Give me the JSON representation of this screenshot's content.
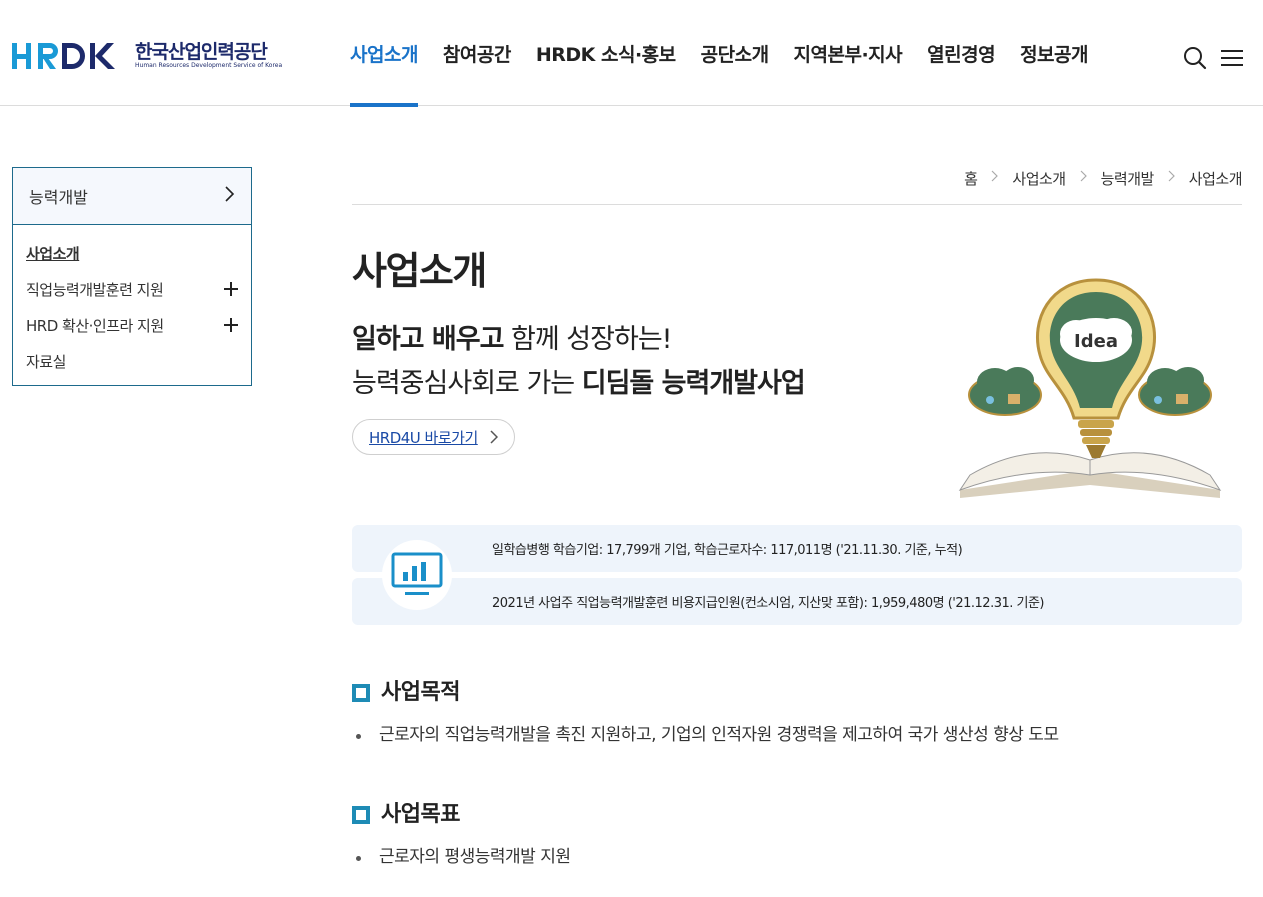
{
  "header": {
    "logo_ko": "한국산업인력공단",
    "logo_en": "Human Resources Development Service of Korea",
    "nav": [
      {
        "label": "사업소개"
      },
      {
        "label": "참여공간"
      },
      {
        "label": "HRDK 소식·홍보"
      },
      {
        "label": "공단소개"
      },
      {
        "label": "지역본부·지사"
      },
      {
        "label": "열린경영"
      },
      {
        "label": "정보공개"
      }
    ],
    "icons": {
      "search": "search-icon",
      "menu": "hamburger-menu-icon"
    }
  },
  "sidebar": {
    "heading": "능력개발",
    "items": [
      {
        "label": "사업소개"
      },
      {
        "label": "직업능력개발훈련 지원"
      },
      {
        "label": "HRD 확산·인프라 지원"
      },
      {
        "label": "자료실"
      }
    ]
  },
  "breadcrumb": [
    "홈",
    "사업소개",
    "능력개발",
    "사업소개"
  ],
  "main": {
    "title": "사업소개",
    "slogan_line1_bold_a": "일하고 배우고",
    "slogan_line1_rest": " 함께 성장하는!",
    "slogan_line2_a": "능력중심사회로 가는 ",
    "slogan_line2_bold": "디딤돌 능력개발사업",
    "hrd_button": "HRD4U 바로가기",
    "illustration_word": "Idea",
    "stats": [
      "일학습병행 학습기업: 17,799개 기업, 학습근로자수: 117,011명 ('21.11.30. 기준, 누적)",
      "2021년 사업주 직업능력개발훈련 비용지급인원(컨소시엄, 지산맞 포함): 1,959,480명 ('21.12.31. 기준)"
    ],
    "sections": [
      {
        "title": "사업목적",
        "bullet": "근로자의 직업능력개발을 촉진 지원하고, 기업의 인적자원 경쟁력을 제고하여 국가 생산성 향상 도모"
      },
      {
        "title": "사업목표",
        "bullet": "근로자의 평생능력개발 지원"
      }
    ]
  },
  "colors": {
    "accent": "#1a73c9",
    "brand_navy": "#1d2a6b",
    "section_mark": "#1e8bb5",
    "stats_bg": "#eef4fb"
  }
}
